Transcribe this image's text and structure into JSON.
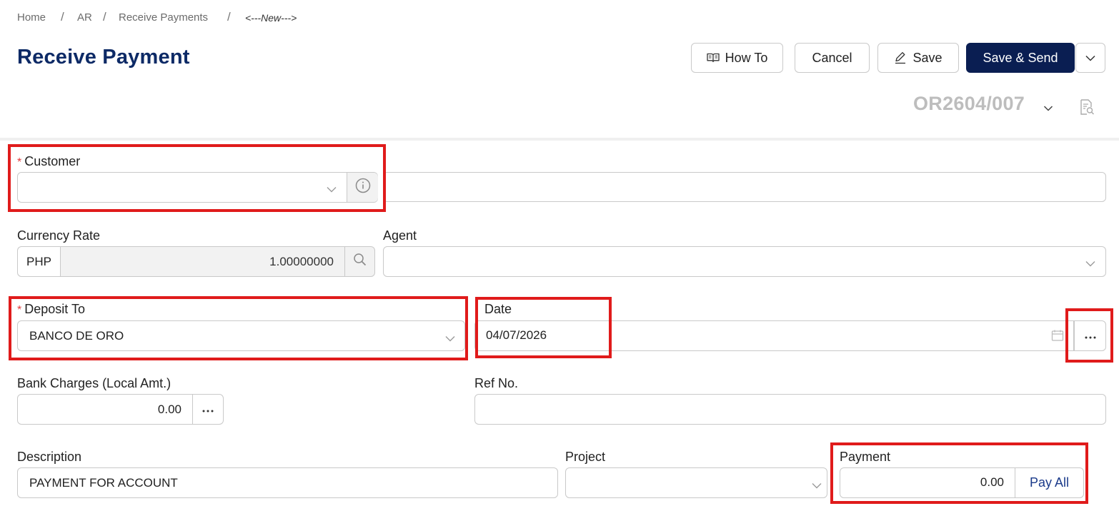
{
  "breadcrumb": {
    "items": [
      "Home",
      "AR",
      "Receive Payments"
    ],
    "current": "<---New--->",
    "separator": "/"
  },
  "page": {
    "title": "Receive Payment"
  },
  "toolbar": {
    "how_to": "How To",
    "cancel": "Cancel",
    "save": "Save",
    "save_send": "Save & Send"
  },
  "document": {
    "number": "OR2604/007"
  },
  "form": {
    "customer": {
      "label": "Customer",
      "value": "",
      "required": true
    },
    "customer_name": {
      "value": ""
    },
    "currency_rate": {
      "label": "Currency Rate",
      "currency": "PHP",
      "rate": "1.00000000"
    },
    "agent": {
      "label": "Agent",
      "value": ""
    },
    "deposit_to": {
      "label": "Deposit To",
      "value": "BANCO DE ORO",
      "required": true
    },
    "date": {
      "label": "Date",
      "value": "04/07/2026"
    },
    "bank_charges": {
      "label": "Bank Charges (Local Amt.)",
      "value": "0.00"
    },
    "ref_no": {
      "label": "Ref No.",
      "value": ""
    },
    "description": {
      "label": "Description",
      "value": "PAYMENT FOR ACCOUNT"
    },
    "project": {
      "label": "Project",
      "value": ""
    },
    "payment": {
      "label": "Payment",
      "value": "0.00",
      "pay_all": "Pay All"
    }
  },
  "icons": {
    "how_to": "book-icon",
    "save": "pencil-icon",
    "doc_preview": "document-search-icon",
    "customer_info": "info-icon",
    "rate_search": "search-icon",
    "date_picker": "calendar-icon",
    "more": "ellipsis-icon"
  },
  "colors": {
    "title": "#0d2a66",
    "primary_button": "#0a1e52",
    "highlight_box": "#e01b1b",
    "required_star": "#e23b3b",
    "doc_number": "#bdbdbd",
    "pay_all_text": "#1a3a8a"
  }
}
